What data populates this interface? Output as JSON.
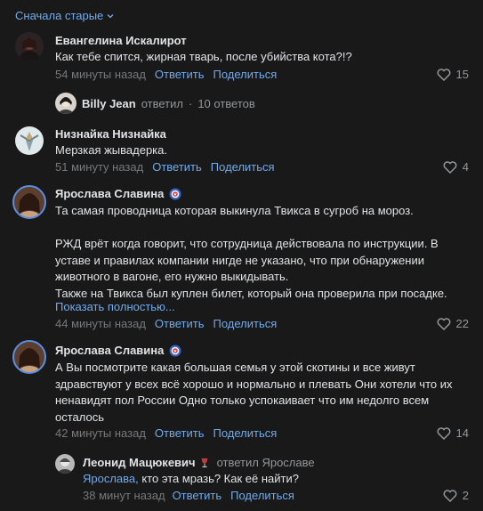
{
  "sort": {
    "label": "Сначала старые"
  },
  "comments": [
    {
      "author": "Евангелина Искалирот",
      "text": "Как тебе спится, жирная тварь, после убийства кота?!?",
      "time": "54 минуты назад",
      "reply": "Ответить",
      "share": "Поделиться",
      "likes": "15"
    },
    {
      "author": "Низнайка Низнайка",
      "text": "Мерзкая жываде­рка.",
      "time": "51 минуту назад",
      "reply": "Ответить",
      "share": "Поделиться",
      "likes": "4"
    },
    {
      "author": "Ярослава Славина",
      "text_lines": [
        "Та самая проводница которая выкинула Твикса в сугроб на мороз.",
        "",
        "РЖД врёт когда говорит, что сотрудница действовала по инструкции. В уставе и правилах компании нигде не указано, что при обнаружении животного в вагоне, его нужно выкидывать.",
        "Также на Твикса был куплен билет, который она проверила при посадке."
      ],
      "show_more": "Показать полностью...",
      "time": "44 минуты назад",
      "reply": "Ответить",
      "share": "Поделиться",
      "likes": "22"
    },
    {
      "author": "Ярослава Славина",
      "text": "А Вы посмотрите какая большая семья у этой скотины и все живут здравствуют у всех всё хорошо и нормально и плевать Они хотели что их ненавидят пол России Одно только успокаивает что им недолго всем осталось",
      "time": "42 минуты назад",
      "reply": "Ответить",
      "share": "Поделиться",
      "likes": "14"
    }
  ],
  "thread": {
    "author": "Billy Jean",
    "verb": "ответил",
    "separator": "·",
    "count": "10 ответов"
  },
  "nested_reply": {
    "author": "Леонид Мацюкевич",
    "replied_to": "ответил Ярославе",
    "mention": "Ярослава,",
    "text": " кто эта мразь? Как её найти?",
    "time": "38 минут назад",
    "reply": "Ответить",
    "share": "Поделиться",
    "likes": "2"
  },
  "colors": {
    "background": "#19191a",
    "link": "#71aaeb",
    "muted": "#76787a",
    "text": "#e1e3e6"
  }
}
